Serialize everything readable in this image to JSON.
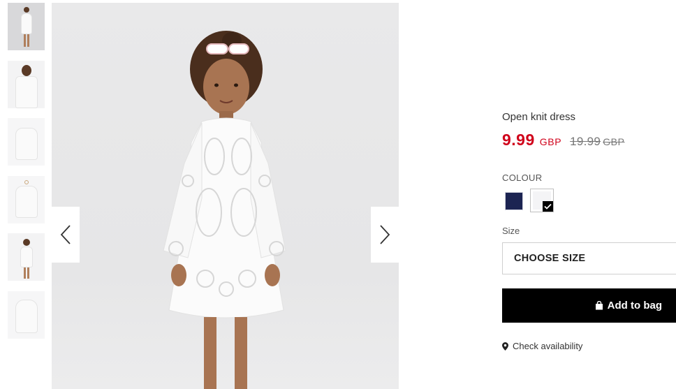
{
  "product": {
    "title": "Open knit dress",
    "price_current": "9.99",
    "currency_current": "GBP",
    "price_original": "19.99",
    "currency_original": "GBP"
  },
  "colour": {
    "label": "COLOUR",
    "options": [
      {
        "name": "navy",
        "hex": "#1c2452",
        "selected": false
      },
      {
        "name": "white",
        "hex": "#f4f4f6",
        "selected": true
      }
    ]
  },
  "size": {
    "label": "Size",
    "selected": "CHOOSE SIZE"
  },
  "actions": {
    "add_to_bag": "Add to bag",
    "check_availability": "Check availability"
  },
  "gallery": {
    "thumbnail_count": 6,
    "active_index": 0,
    "icons": [
      "chevron-left-icon",
      "chevron-right-icon",
      "bag-icon",
      "location-pin-icon",
      "checkmark-icon"
    ]
  },
  "colors": {
    "price_sale": "#d0021b",
    "button_bg": "#000000",
    "swatch_navy": "#1c2452"
  }
}
